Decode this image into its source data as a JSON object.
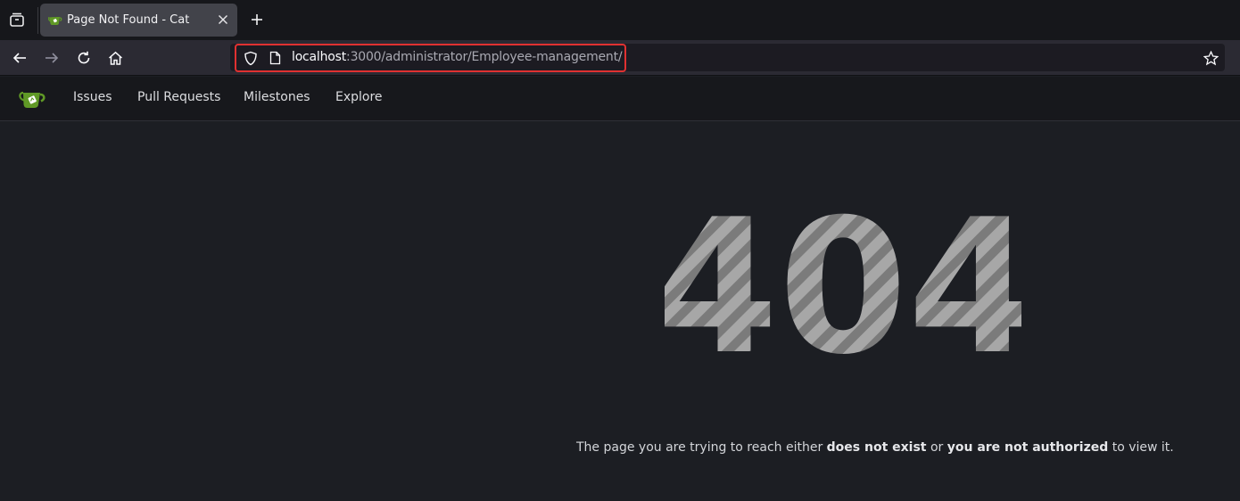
{
  "browser": {
    "tab": {
      "title": "Page Not Found - Cat"
    },
    "url": {
      "host": "localhost",
      "rest": ":3000/administrator/Employee-management/"
    }
  },
  "site_nav": {
    "items": [
      {
        "label": "Issues"
      },
      {
        "label": "Pull Requests"
      },
      {
        "label": "Milestones"
      },
      {
        "label": "Explore"
      }
    ]
  },
  "error": {
    "code": "404",
    "message_prefix": "The page you are trying to reach either ",
    "bold_1": "does not exist",
    "message_mid": " or ",
    "bold_2": "you are not authorized",
    "message_suffix": " to view it."
  },
  "colors": {
    "accent_green": "#609926",
    "highlight_red": "#e03131",
    "page_bg": "#1c1e23"
  }
}
